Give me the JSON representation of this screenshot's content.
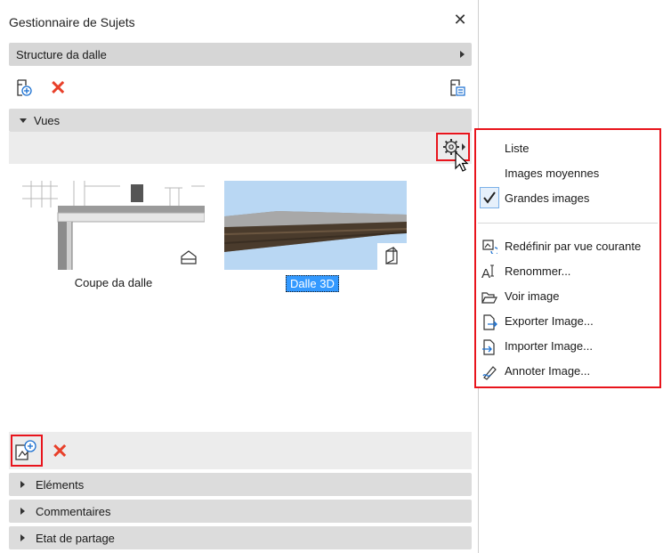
{
  "window": {
    "title": "Gestionnaire de Sujets",
    "close_label": "✕"
  },
  "topic_selector": {
    "value": "Structure da dalle"
  },
  "sections": {
    "views": {
      "label": "Vues"
    },
    "elements": {
      "label": "Eléments"
    },
    "comments": {
      "label": "Commentaires"
    },
    "sharing": {
      "label": "Etat de partage"
    }
  },
  "views": [
    {
      "label": "Coupe da dalle",
      "type_icon": "section-view-icon",
      "selected": false
    },
    {
      "label": "Dalle 3D",
      "type_icon": "3d-view-icon",
      "selected": true
    }
  ],
  "context_menu": {
    "view_modes": [
      {
        "label": "Liste",
        "checked": false
      },
      {
        "label": "Images moyennes",
        "checked": false
      },
      {
        "label": "Grandes images",
        "checked": true
      }
    ],
    "actions": [
      {
        "label": "Redéfinir par vue courante",
        "icon": "redefine-view-icon"
      },
      {
        "label": "Renommer...",
        "icon": "rename-icon"
      },
      {
        "label": "Voir image",
        "icon": "open-folder-icon"
      },
      {
        "label": "Exporter Image...",
        "icon": "export-image-icon"
      },
      {
        "label": "Importer Image...",
        "icon": "import-image-icon"
      },
      {
        "label": "Annoter Image...",
        "icon": "annotate-icon"
      }
    ]
  },
  "colors": {
    "highlight_red": "#e8141c",
    "delete_red": "#e8402a",
    "selection_blue": "#3399ff",
    "section_bar": "#dcdcdc"
  }
}
